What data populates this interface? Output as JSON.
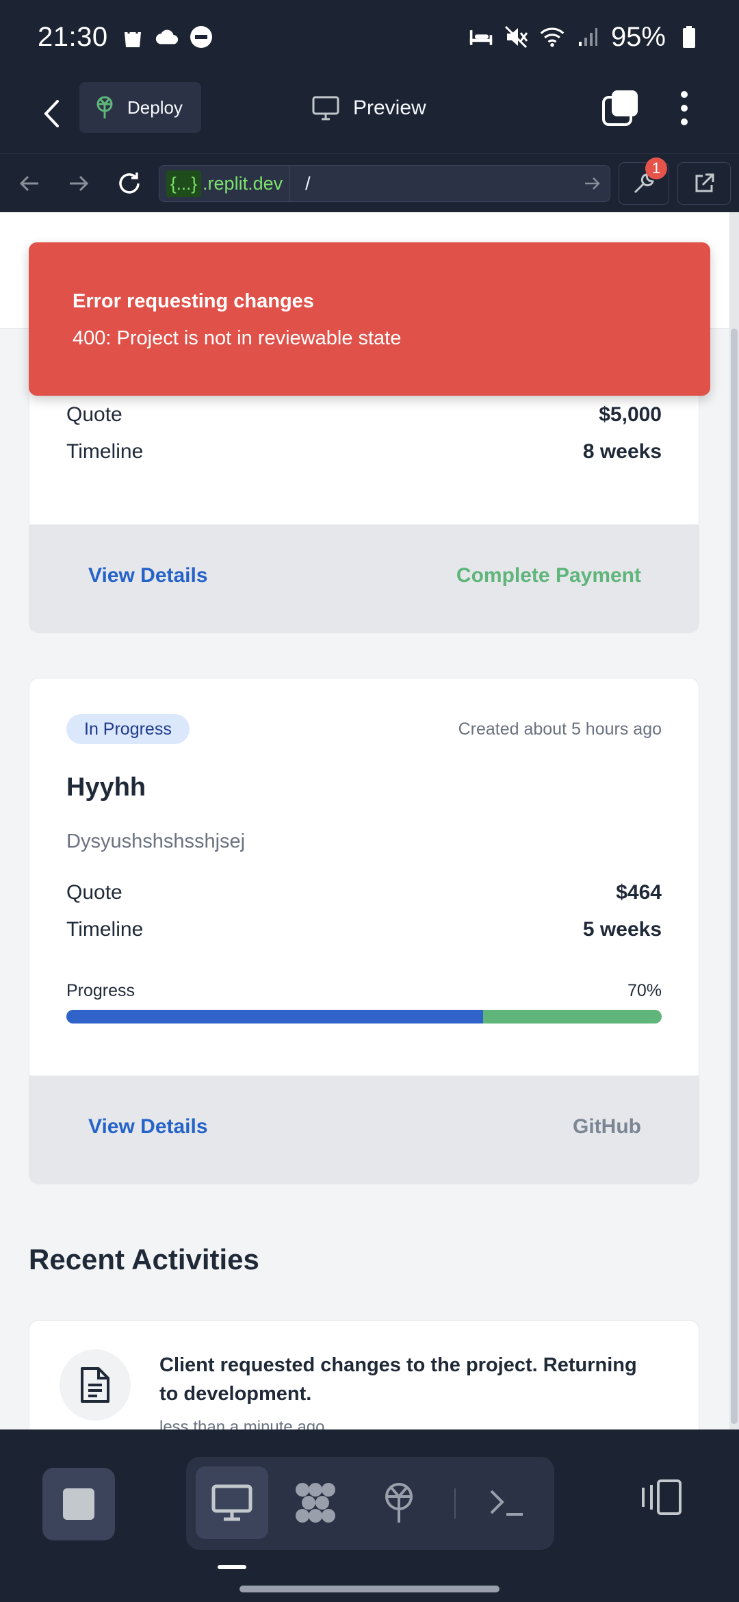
{
  "status_bar": {
    "time": "21:30",
    "battery": "95%",
    "left_icons": [
      "shopping-bag-icon",
      "cloud-icon",
      "do-not-disturb-icon"
    ],
    "right_icons": [
      "sleep-mode-icon",
      "mute-icon",
      "wifi-icon",
      "signal-icon",
      "battery-icon"
    ]
  },
  "header": {
    "deploy_label": "Deploy",
    "preview_label": "Preview"
  },
  "browser": {
    "url_chip": "{...}",
    "url_host": ".replit.dev",
    "url_path": "/",
    "devtools_badge": "1"
  },
  "toast": {
    "title": "Error requesting changes",
    "message": "400: Project is not in reviewable state",
    "color": "#e05149"
  },
  "project_cards": [
    {
      "quote_label": "Quote",
      "quote_value": "$5,000",
      "timeline_label": "Timeline",
      "timeline_value": "8 weeks",
      "view_details": "View Details",
      "secondary_action": "Complete Payment",
      "secondary_color": "#5fb57a"
    },
    {
      "status": "In Progress",
      "created": "Created about 5 hours ago",
      "title": "Hyyhh",
      "description": "Dysyushshshsshjsej",
      "quote_label": "Quote",
      "quote_value": "$464",
      "timeline_label": "Timeline",
      "timeline_value": "5 weeks",
      "progress_label": "Progress",
      "progress_text": "70%",
      "progress_fraction": 0.7,
      "view_details": "View Details",
      "secondary_action": "GitHub",
      "secondary_color": "#7c8593"
    }
  ],
  "activities": {
    "heading": "Recent Activities",
    "items": [
      {
        "text": "Client requested changes to the project. Returning to development.",
        "time": "less than a minute ago",
        "icon": "document-icon"
      }
    ]
  },
  "dock": {
    "tools": [
      "desktop-icon",
      "workspace-icon",
      "deploy-icon",
      "terminal-icon"
    ]
  }
}
